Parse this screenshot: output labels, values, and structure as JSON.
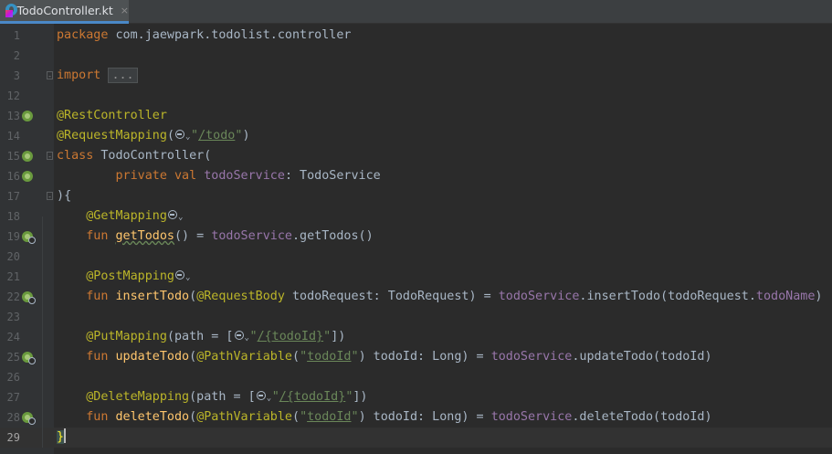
{
  "editor": {
    "tab": {
      "title": "TodoController.kt",
      "close": "×",
      "icon": "kotlin-file-icon"
    },
    "lines": [
      {
        "n": "1",
        "segments": [
          [
            "kw",
            "package"
          ],
          [
            "t",
            " com.jaewpark.todolist.controller"
          ]
        ]
      },
      {
        "n": "2",
        "segments": []
      },
      {
        "n": "3",
        "fold": true,
        "segments": [
          [
            "kw",
            "import"
          ],
          [
            "t",
            " "
          ],
          [
            "fold",
            "..."
          ]
        ]
      },
      {
        "n": "12",
        "segments": []
      },
      {
        "n": "13",
        "icon": "spring-bean-icon",
        "segments": [
          [
            "ann",
            "@RestController"
          ]
        ]
      },
      {
        "n": "14",
        "segments": [
          [
            "ann",
            "@RequestMapping"
          ],
          [
            "t",
            "("
          ],
          [
            "icon",
            "web-endpoint-icon"
          ],
          [
            "str",
            "\""
          ],
          [
            "strl",
            "/todo"
          ],
          [
            "str",
            "\""
          ],
          [
            "t",
            ")"
          ]
        ]
      },
      {
        "n": "15",
        "icon": "spring-bean-icon",
        "fold": true,
        "segments": [
          [
            "kw",
            "class"
          ],
          [
            "t",
            " TodoController("
          ]
        ]
      },
      {
        "n": "16",
        "icon": "spring-bean-icon",
        "segments": [
          [
            "t",
            "        "
          ],
          [
            "kw",
            "private val"
          ],
          [
            "t",
            " "
          ],
          [
            "fld",
            "todoService"
          ],
          [
            "t",
            ": TodoService"
          ]
        ]
      },
      {
        "n": "17",
        "fold": true,
        "segments": [
          [
            "t",
            ")"
          ],
          [
            "t",
            "{"
          ]
        ]
      },
      {
        "n": "18",
        "segments": [
          [
            "t",
            "    "
          ],
          [
            "ann",
            "@GetMapping"
          ],
          [
            "icon",
            "web-endpoint-icon"
          ]
        ]
      },
      {
        "n": "19",
        "icon": "spring-web-icon",
        "segments": [
          [
            "t",
            "    "
          ],
          [
            "kw",
            "fun"
          ],
          [
            "t",
            " "
          ],
          [
            "fnw",
            "getTodos"
          ],
          [
            "t",
            "() = "
          ],
          [
            "fld",
            "todoService"
          ],
          [
            "t",
            ".getTodos()"
          ]
        ]
      },
      {
        "n": "20",
        "segments": []
      },
      {
        "n": "21",
        "segments": [
          [
            "t",
            "    "
          ],
          [
            "ann",
            "@PostMapping"
          ],
          [
            "icon",
            "web-endpoint-icon"
          ]
        ]
      },
      {
        "n": "22",
        "icon": "spring-web-icon",
        "segments": [
          [
            "t",
            "    "
          ],
          [
            "kw",
            "fun"
          ],
          [
            "t",
            " "
          ],
          [
            "fn",
            "insertTodo"
          ],
          [
            "t",
            "("
          ],
          [
            "ann",
            "@RequestBody"
          ],
          [
            "t",
            " todoRequest: TodoRequest) = "
          ],
          [
            "fld",
            "todoService"
          ],
          [
            "t",
            ".insertTodo(todoRequest."
          ],
          [
            "fld",
            "todoName"
          ],
          [
            "t",
            ")"
          ]
        ]
      },
      {
        "n": "23",
        "segments": []
      },
      {
        "n": "24",
        "segments": [
          [
            "t",
            "    "
          ],
          [
            "ann",
            "@PutMapping"
          ],
          [
            "t",
            "(path = ["
          ],
          [
            "icon",
            "web-endpoint-icon"
          ],
          [
            "str",
            "\""
          ],
          [
            "strl",
            "/{todoId}"
          ],
          [
            "str",
            "\""
          ],
          [
            "t",
            "])"
          ]
        ]
      },
      {
        "n": "25",
        "icon": "spring-web-icon",
        "segments": [
          [
            "t",
            "    "
          ],
          [
            "kw",
            "fun"
          ],
          [
            "t",
            " "
          ],
          [
            "fn",
            "updateTodo"
          ],
          [
            "t",
            "("
          ],
          [
            "ann",
            "@PathVariable"
          ],
          [
            "t",
            "("
          ],
          [
            "str",
            "\""
          ],
          [
            "strl",
            "todoId"
          ],
          [
            "str",
            "\""
          ],
          [
            "t",
            ") todoId: Long) = "
          ],
          [
            "fld",
            "todoService"
          ],
          [
            "t",
            ".updateTodo(todoId)"
          ]
        ]
      },
      {
        "n": "26",
        "segments": []
      },
      {
        "n": "27",
        "segments": [
          [
            "t",
            "    "
          ],
          [
            "ann",
            "@DeleteMapping"
          ],
          [
            "t",
            "(path = ["
          ],
          [
            "icon",
            "web-endpoint-icon"
          ],
          [
            "str",
            "\""
          ],
          [
            "strl",
            "/{todoId}"
          ],
          [
            "str",
            "\""
          ],
          [
            "t",
            "])"
          ]
        ]
      },
      {
        "n": "28",
        "icon": "spring-web-icon",
        "segments": [
          [
            "t",
            "    "
          ],
          [
            "kw",
            "fun"
          ],
          [
            "t",
            " "
          ],
          [
            "fn",
            "deleteTodo"
          ],
          [
            "t",
            "("
          ],
          [
            "ann",
            "@PathVariable"
          ],
          [
            "t",
            "("
          ],
          [
            "str",
            "\""
          ],
          [
            "strl",
            "todoId"
          ],
          [
            "str",
            "\""
          ],
          [
            "t",
            ") todoId: Long) = "
          ],
          [
            "fld",
            "todoService"
          ],
          [
            "t",
            ".deleteTodo(todoId)"
          ]
        ]
      },
      {
        "n": "29",
        "current": true,
        "segments": [
          [
            "brace",
            "}"
          ],
          [
            "caret",
            ""
          ]
        ]
      }
    ]
  }
}
